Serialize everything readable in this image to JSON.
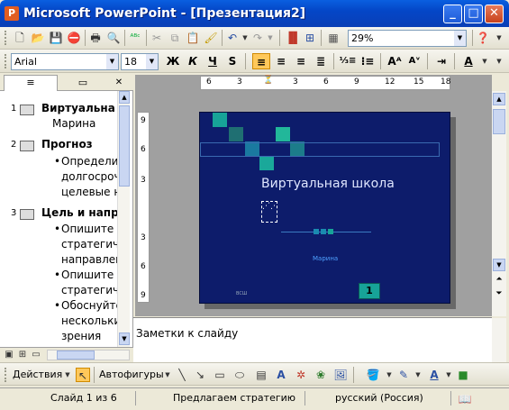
{
  "app": {
    "title": "Microsoft PowerPoint - [Презентация2]",
    "logo_letter": "P"
  },
  "window_buttons": {
    "minimize": "_",
    "maximize": "□",
    "close": "✕"
  },
  "standard_toolbar": {
    "zoom": "29%"
  },
  "formatting_toolbar": {
    "font": "Arial",
    "size": "18",
    "bold": "Ж",
    "italic": "К",
    "underline": "Ч",
    "shadow": "S"
  },
  "left_pane": {
    "tabs": {
      "outline": "≡",
      "slides": "▭",
      "close": "✕"
    },
    "outline": [
      {
        "num": "1",
        "text": "Виртуальна",
        "level": 0
      },
      {
        "num": "",
        "text": "Марина",
        "level": 1
      },
      {
        "num": "2",
        "text": "Прогноз",
        "level": 0
      },
      {
        "num": "",
        "text": "Определи",
        "level": 2
      },
      {
        "num": "",
        "text": "долгосроч",
        "level": 3
      },
      {
        "num": "",
        "text": "целевые н",
        "level": 3
      },
      {
        "num": "3",
        "text": "Цель и напр",
        "level": 0
      },
      {
        "num": "",
        "text": "Опишите",
        "level": 2
      },
      {
        "num": "",
        "text": "стратегич",
        "level": 3
      },
      {
        "num": "",
        "text": "направлен",
        "level": 3
      },
      {
        "num": "",
        "text": "Опишите",
        "level": 2
      },
      {
        "num": "",
        "text": "стратегич",
        "level": 3
      },
      {
        "num": "",
        "text": "Обоснуйте",
        "level": 2
      },
      {
        "num": "",
        "text": "нескольки",
        "level": 3
      },
      {
        "num": "",
        "text": "зрения",
        "level": 3
      }
    ]
  },
  "ruler": {
    "h": [
      "6",
      "3",
      "3",
      "6",
      "9",
      "12",
      "15",
      "18"
    ],
    "v": [
      "9",
      "6",
      "3",
      "3",
      "6",
      "9"
    ]
  },
  "slide": {
    "title": "Виртуальная школа",
    "subtitle": "Марина",
    "footer": "ВСШ",
    "page_number": "1"
  },
  "notes": {
    "placeholder": "Заметки к слайду"
  },
  "drawing_toolbar": {
    "actions": "Действия",
    "autoshapes": "Автофигуры"
  },
  "status": {
    "slide": "Слайд 1 из 6",
    "design": "Предлагаем стратегию",
    "language": "русский (Россия)"
  }
}
